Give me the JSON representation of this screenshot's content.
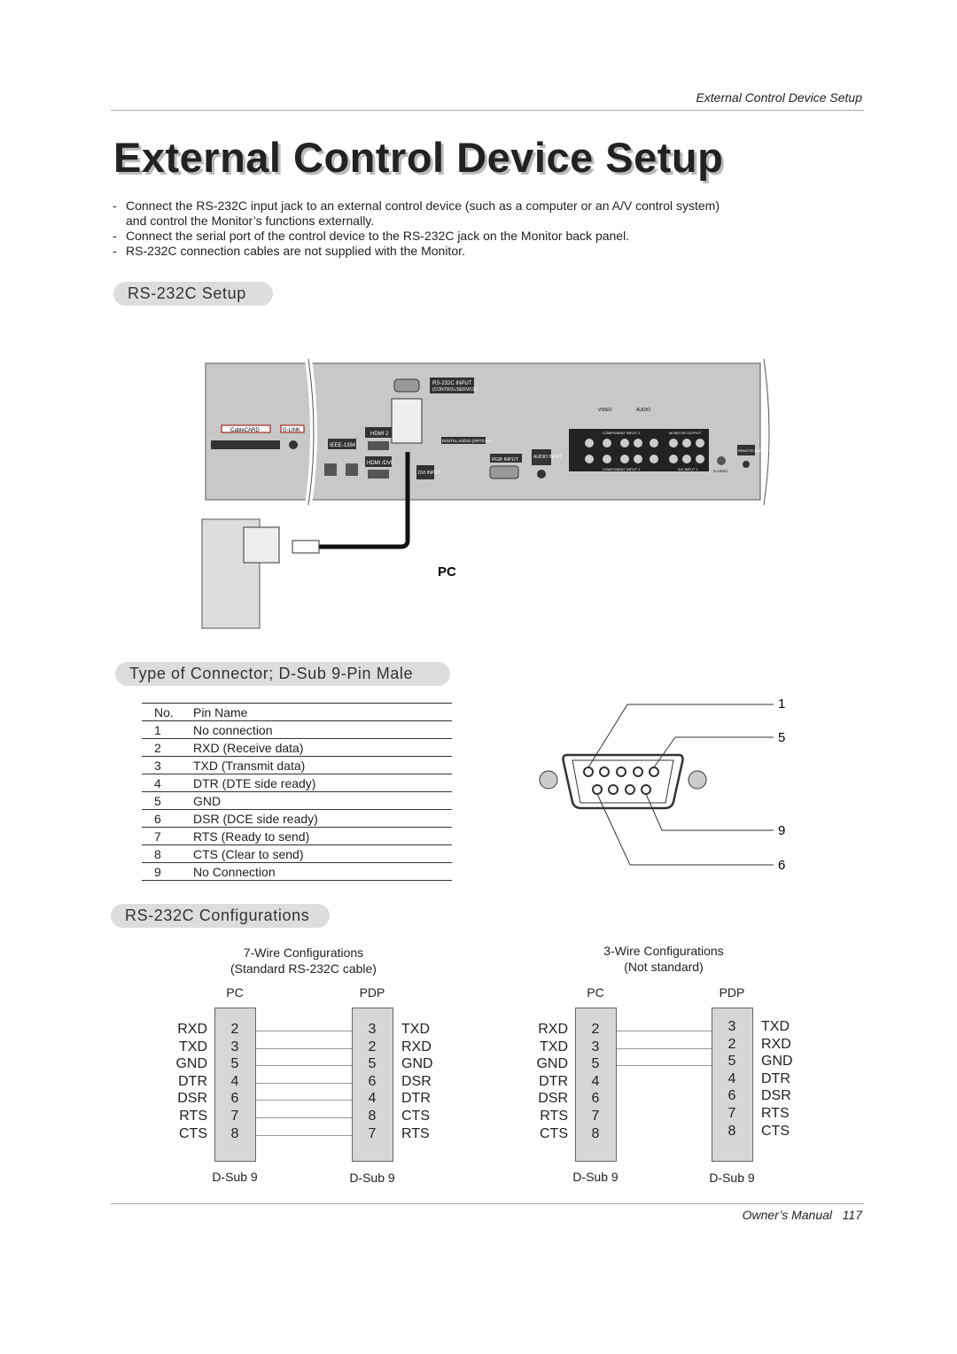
{
  "header": {
    "running_title": "External Control Device Setup"
  },
  "title": "External Control Device Setup",
  "bullets": [
    "Connect the RS-232C input jack to an external control device (such as a computer or an A/V control system)",
    "and control the Monitor’s functions externally.",
    "Connect the serial port of the control device to the RS-232C jack on the Monitor back panel.",
    "RS-232C connection cables are not supplied with the Monitor."
  ],
  "sections": {
    "setup": "RS-232C Setup",
    "connector": "Type of Connector; D-Sub 9-Pin Male",
    "configs": "RS-232C Configurations"
  },
  "panel": {
    "rs232c": "RS-232C INPUT",
    "rs232c_sub": "(CONTROL/SERVICE)",
    "cablecard": "CableCARD",
    "glink": "G-LINK",
    "ieee": "IEEE-1394",
    "hdmi2": "HDMI 2",
    "hdmi_dvi": "HDMI /DVI",
    "dvi": "DVI INPUT",
    "rgb": "RGB INPUT",
    "audio": "AUDIO INPUT",
    "digital_audio": "DIGITAL AUDIO (OPTICAL)",
    "component2": "COMPONENT INPUT 2",
    "component1": "COMPONENT INPUT 1",
    "monitor_out": "MONITOR OUTPUT",
    "av1": "A/V INPUT 1",
    "svideo": "S-VIDEO",
    "remote": "REMOTE CONTROL",
    "video": "VIDEO",
    "audio_lbl": "AUDIO"
  },
  "pc_label": "PC",
  "pin_table": {
    "headers": [
      "No.",
      "Pin Name"
    ],
    "rows": [
      [
        "1",
        "No connection"
      ],
      [
        "2",
        "RXD (Receive data)"
      ],
      [
        "3",
        "TXD (Transmit data)"
      ],
      [
        "4",
        "DTR (DTE side ready)"
      ],
      [
        "5",
        "GND"
      ],
      [
        "6",
        "DSR (DCE side ready)"
      ],
      [
        "7",
        "RTS (Ready to send)"
      ],
      [
        "8",
        "CTS (Clear to send)"
      ],
      [
        "9",
        "No Connection"
      ]
    ]
  },
  "connector_labels": [
    "1",
    "5",
    "9",
    "6"
  ],
  "configs": [
    {
      "title": "7-Wire Configurations",
      "subtitle": "(Standard RS-232C cable)",
      "left_head": "PC",
      "right_head": "PDP",
      "left_foot": "D-Sub 9",
      "right_foot": "D-Sub 9",
      "left": [
        [
          "RXD",
          "2"
        ],
        [
          "TXD",
          "3"
        ],
        [
          "GND",
          "5"
        ],
        [
          "DTR",
          "4"
        ],
        [
          "DSR",
          "6"
        ],
        [
          "RTS",
          "7"
        ],
        [
          "CTS",
          "8"
        ]
      ],
      "right": [
        [
          "3",
          "TXD"
        ],
        [
          "2",
          "RXD"
        ],
        [
          "5",
          "GND"
        ],
        [
          "6",
          "DSR"
        ],
        [
          "4",
          "DTR"
        ],
        [
          "8",
          "CTS"
        ],
        [
          "7",
          "RTS"
        ]
      ],
      "wires": 7
    },
    {
      "title": "3-Wire Configurations",
      "subtitle": "(Not standard)",
      "left_head": "PC",
      "right_head": "PDP",
      "left_foot": "D-Sub 9",
      "right_foot": "D-Sub 9",
      "left": [
        [
          "RXD",
          "2"
        ],
        [
          "TXD",
          "3"
        ],
        [
          "GND",
          "5"
        ],
        [
          "DTR",
          "4"
        ],
        [
          "DSR",
          "6"
        ],
        [
          "RTS",
          "7"
        ],
        [
          "CTS",
          "8"
        ]
      ],
      "right": [
        [
          "3",
          "TXD"
        ],
        [
          "2",
          "RXD"
        ],
        [
          "5",
          "GND"
        ],
        [
          "4",
          "DTR"
        ],
        [
          "6",
          "DSR"
        ],
        [
          "7",
          "RTS"
        ],
        [
          "8",
          "CTS"
        ]
      ],
      "wires": 3
    }
  ],
  "footer": {
    "label": "Owner’s Manual",
    "page": "117"
  }
}
